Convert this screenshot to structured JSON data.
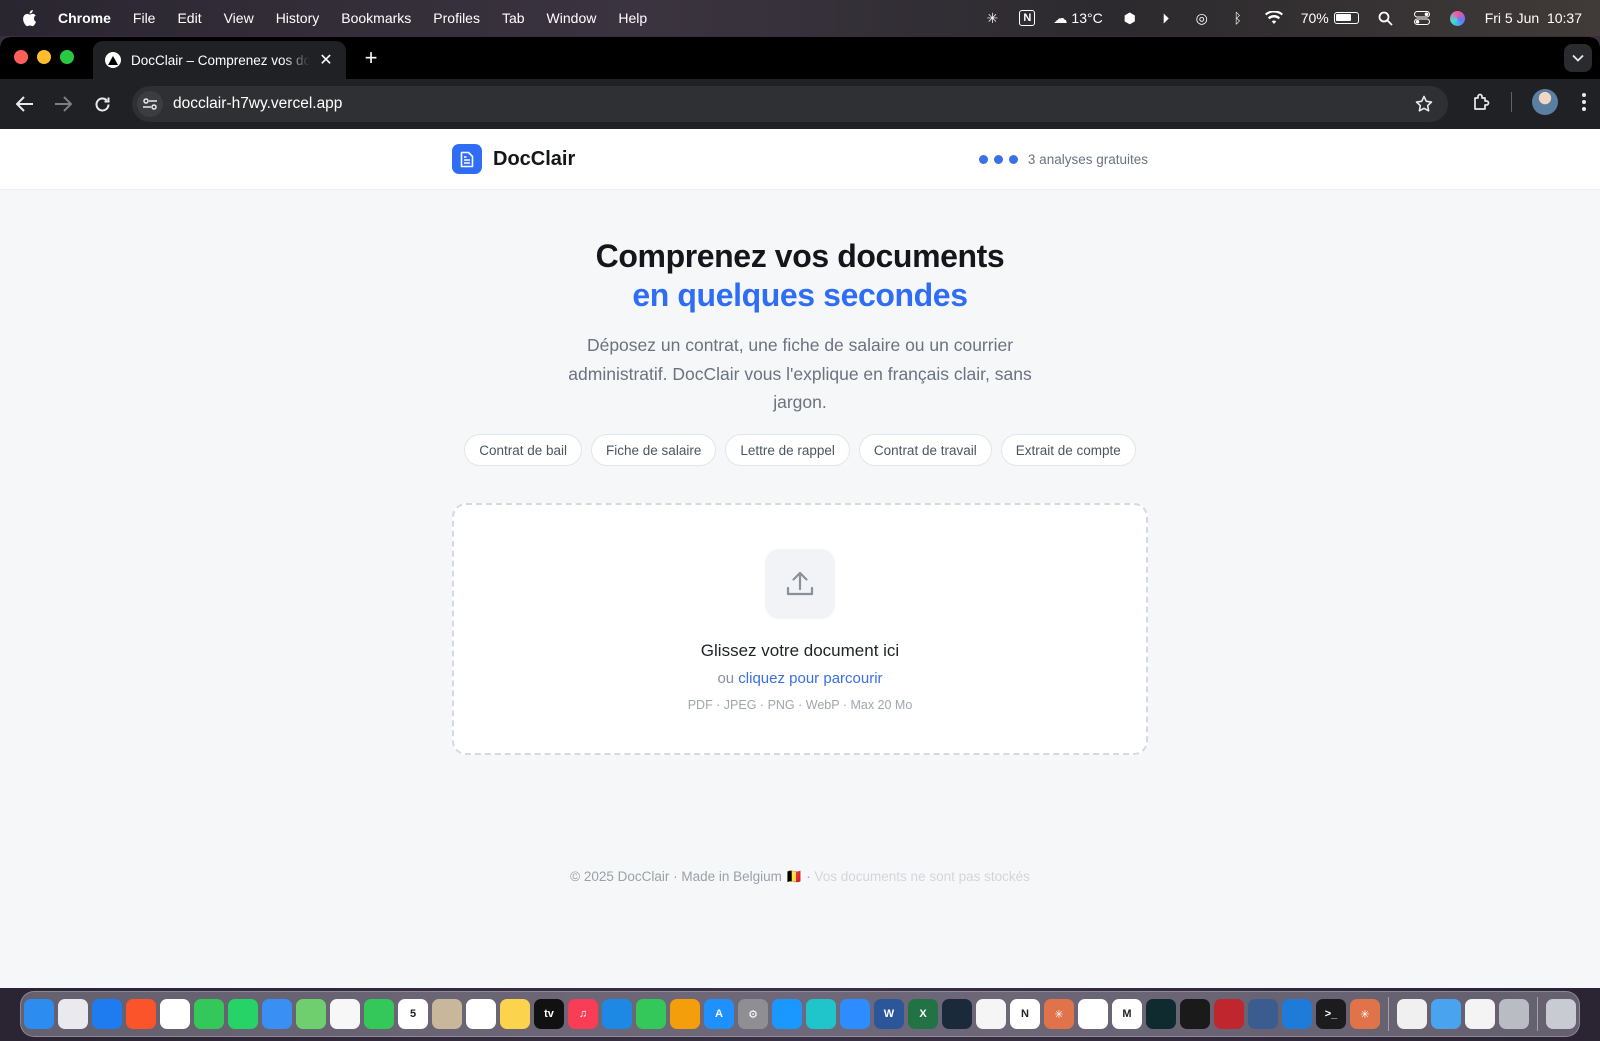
{
  "menubar": {
    "app_name": "Chrome",
    "items": [
      "File",
      "Edit",
      "View",
      "History",
      "Bookmarks",
      "Profiles",
      "Tab",
      "Window",
      "Help"
    ],
    "weather": "13°C",
    "battery": "70%",
    "datetime": "Fri 5 Jun  10:37"
  },
  "browser": {
    "tab_title": "DocClair – Comprenez vos documents en quelques secondes",
    "url": "docclair-h7wy.vercel.app"
  },
  "site": {
    "brand": "DocClair",
    "free_analyses": "3 analyses gratuites",
    "accent_color": "#2f6df6"
  },
  "hero": {
    "title_line1": "Comprenez vos documents",
    "title_line2": "en quelques secondes",
    "subtitle": "Déposez un contrat, une fiche de salaire ou un courrier administratif. DocClair vous l'explique en français clair, sans jargon."
  },
  "chips": [
    "Contrat de bail",
    "Fiche de salaire",
    "Lettre de rappel",
    "Contrat de travail",
    "Extrait de compte"
  ],
  "dropzone": {
    "title": "Glissez votre document ici",
    "or": "ou",
    "browse_link": "cliquez pour parcourir",
    "formats": "PDF · JPEG · PNG · WebP · Max 20 Mo"
  },
  "footer": {
    "main": "© 2025 DocClair · Made in Belgium 🇧🇪 ·",
    "muted": "Vos documents ne sont pas stockés"
  },
  "dock": {
    "apps": [
      {
        "name": "finder-icon",
        "color": "#2d8cf0",
        "glyph": ""
      },
      {
        "name": "launchpad-icon",
        "color": "#e9e9ee",
        "glyph": ""
      },
      {
        "name": "safari-icon",
        "color": "#1e7cf0",
        "glyph": ""
      },
      {
        "name": "brave-icon",
        "color": "#fb542b",
        "glyph": ""
      },
      {
        "name": "chrome-icon",
        "color": "#ffffff",
        "glyph": ""
      },
      {
        "name": "messages-icon",
        "color": "#34c759",
        "glyph": ""
      },
      {
        "name": "whatsapp-icon",
        "color": "#25d366",
        "glyph": ""
      },
      {
        "name": "mail-icon",
        "color": "#3a8ff5",
        "glyph": ""
      },
      {
        "name": "maps-icon",
        "color": "#6fcf6f",
        "glyph": ""
      },
      {
        "name": "photos-icon",
        "color": "#f7f7f7",
        "glyph": ""
      },
      {
        "name": "facetime-icon",
        "color": "#34c759",
        "glyph": ""
      },
      {
        "name": "calendar-icon",
        "color": "#ffffff",
        "glyph": "5"
      },
      {
        "name": "contacts-icon",
        "color": "#c8b79a",
        "glyph": ""
      },
      {
        "name": "reminders-icon",
        "color": "#ffffff",
        "glyph": ""
      },
      {
        "name": "notes-icon",
        "color": "#fcd34d",
        "glyph": ""
      },
      {
        "name": "tv-icon",
        "color": "#111111",
        "glyph": "tv"
      },
      {
        "name": "music-icon",
        "color": "#fa3d57",
        "glyph": "♫"
      },
      {
        "name": "keynote-icon",
        "color": "#1e88e5",
        "glyph": ""
      },
      {
        "name": "numbers-icon",
        "color": "#34c759",
        "glyph": ""
      },
      {
        "name": "pages-icon",
        "color": "#f59e0b",
        "glyph": ""
      },
      {
        "name": "app-store-icon",
        "color": "#1e90ff",
        "glyph": "A"
      },
      {
        "name": "system-settings-icon",
        "color": "#8e8e93",
        "glyph": "⚙"
      },
      {
        "name": "prime-video-icon",
        "color": "#1a98ff",
        "glyph": ""
      },
      {
        "name": "canva-icon",
        "color": "#20c4cb",
        "glyph": ""
      },
      {
        "name": "zoom-icon",
        "color": "#2d8cff",
        "glyph": ""
      },
      {
        "name": "word-icon",
        "color": "#2b579a",
        "glyph": "W"
      },
      {
        "name": "excel-icon",
        "color": "#217346",
        "glyph": "X"
      },
      {
        "name": "activity-monitor-icon",
        "color": "#1b2a3a",
        "glyph": ""
      },
      {
        "name": "textedit-icon",
        "color": "#f5f5f5",
        "glyph": ""
      },
      {
        "name": "notion-icon",
        "color": "#ffffff",
        "glyph": "N"
      },
      {
        "name": "claude-icon",
        "color": "#e0734a",
        "glyph": "✳"
      },
      {
        "name": "chatgpt-icon",
        "color": "#ffffff",
        "glyph": ""
      },
      {
        "name": "gmail-icon",
        "color": "#ffffff",
        "glyph": "M"
      },
      {
        "name": "perplexity-icon",
        "color": "#0f2b30",
        "glyph": ""
      },
      {
        "name": "cursor-icon",
        "color": "#1a1a1a",
        "glyph": ""
      },
      {
        "name": "filezilla-icon",
        "color": "#c0262d",
        "glyph": ""
      },
      {
        "name": "disk-utility-icon",
        "color": "#3b5c8f",
        "glyph": ""
      },
      {
        "name": "vscode-icon",
        "color": "#1f7bd8",
        "glyph": ""
      },
      {
        "name": "terminal-icon",
        "color": "#1c1c1e",
        "glyph": ">_"
      },
      {
        "name": "claude-code-icon",
        "color": "#e0734a",
        "glyph": "✳"
      },
      {
        "name": "preview-icon",
        "color": "#f0f0f0",
        "glyph": ""
      },
      {
        "name": "downloads-folder-icon",
        "color": "#4aa3ef",
        "glyph": ""
      },
      {
        "name": "document-icon",
        "color": "#f4f4f4",
        "glyph": ""
      },
      {
        "name": "screenshot-icon",
        "color": "#b9bcc2",
        "glyph": ""
      },
      {
        "name": "trash-icon",
        "color": "#c8ccd2",
        "glyph": ""
      }
    ]
  }
}
